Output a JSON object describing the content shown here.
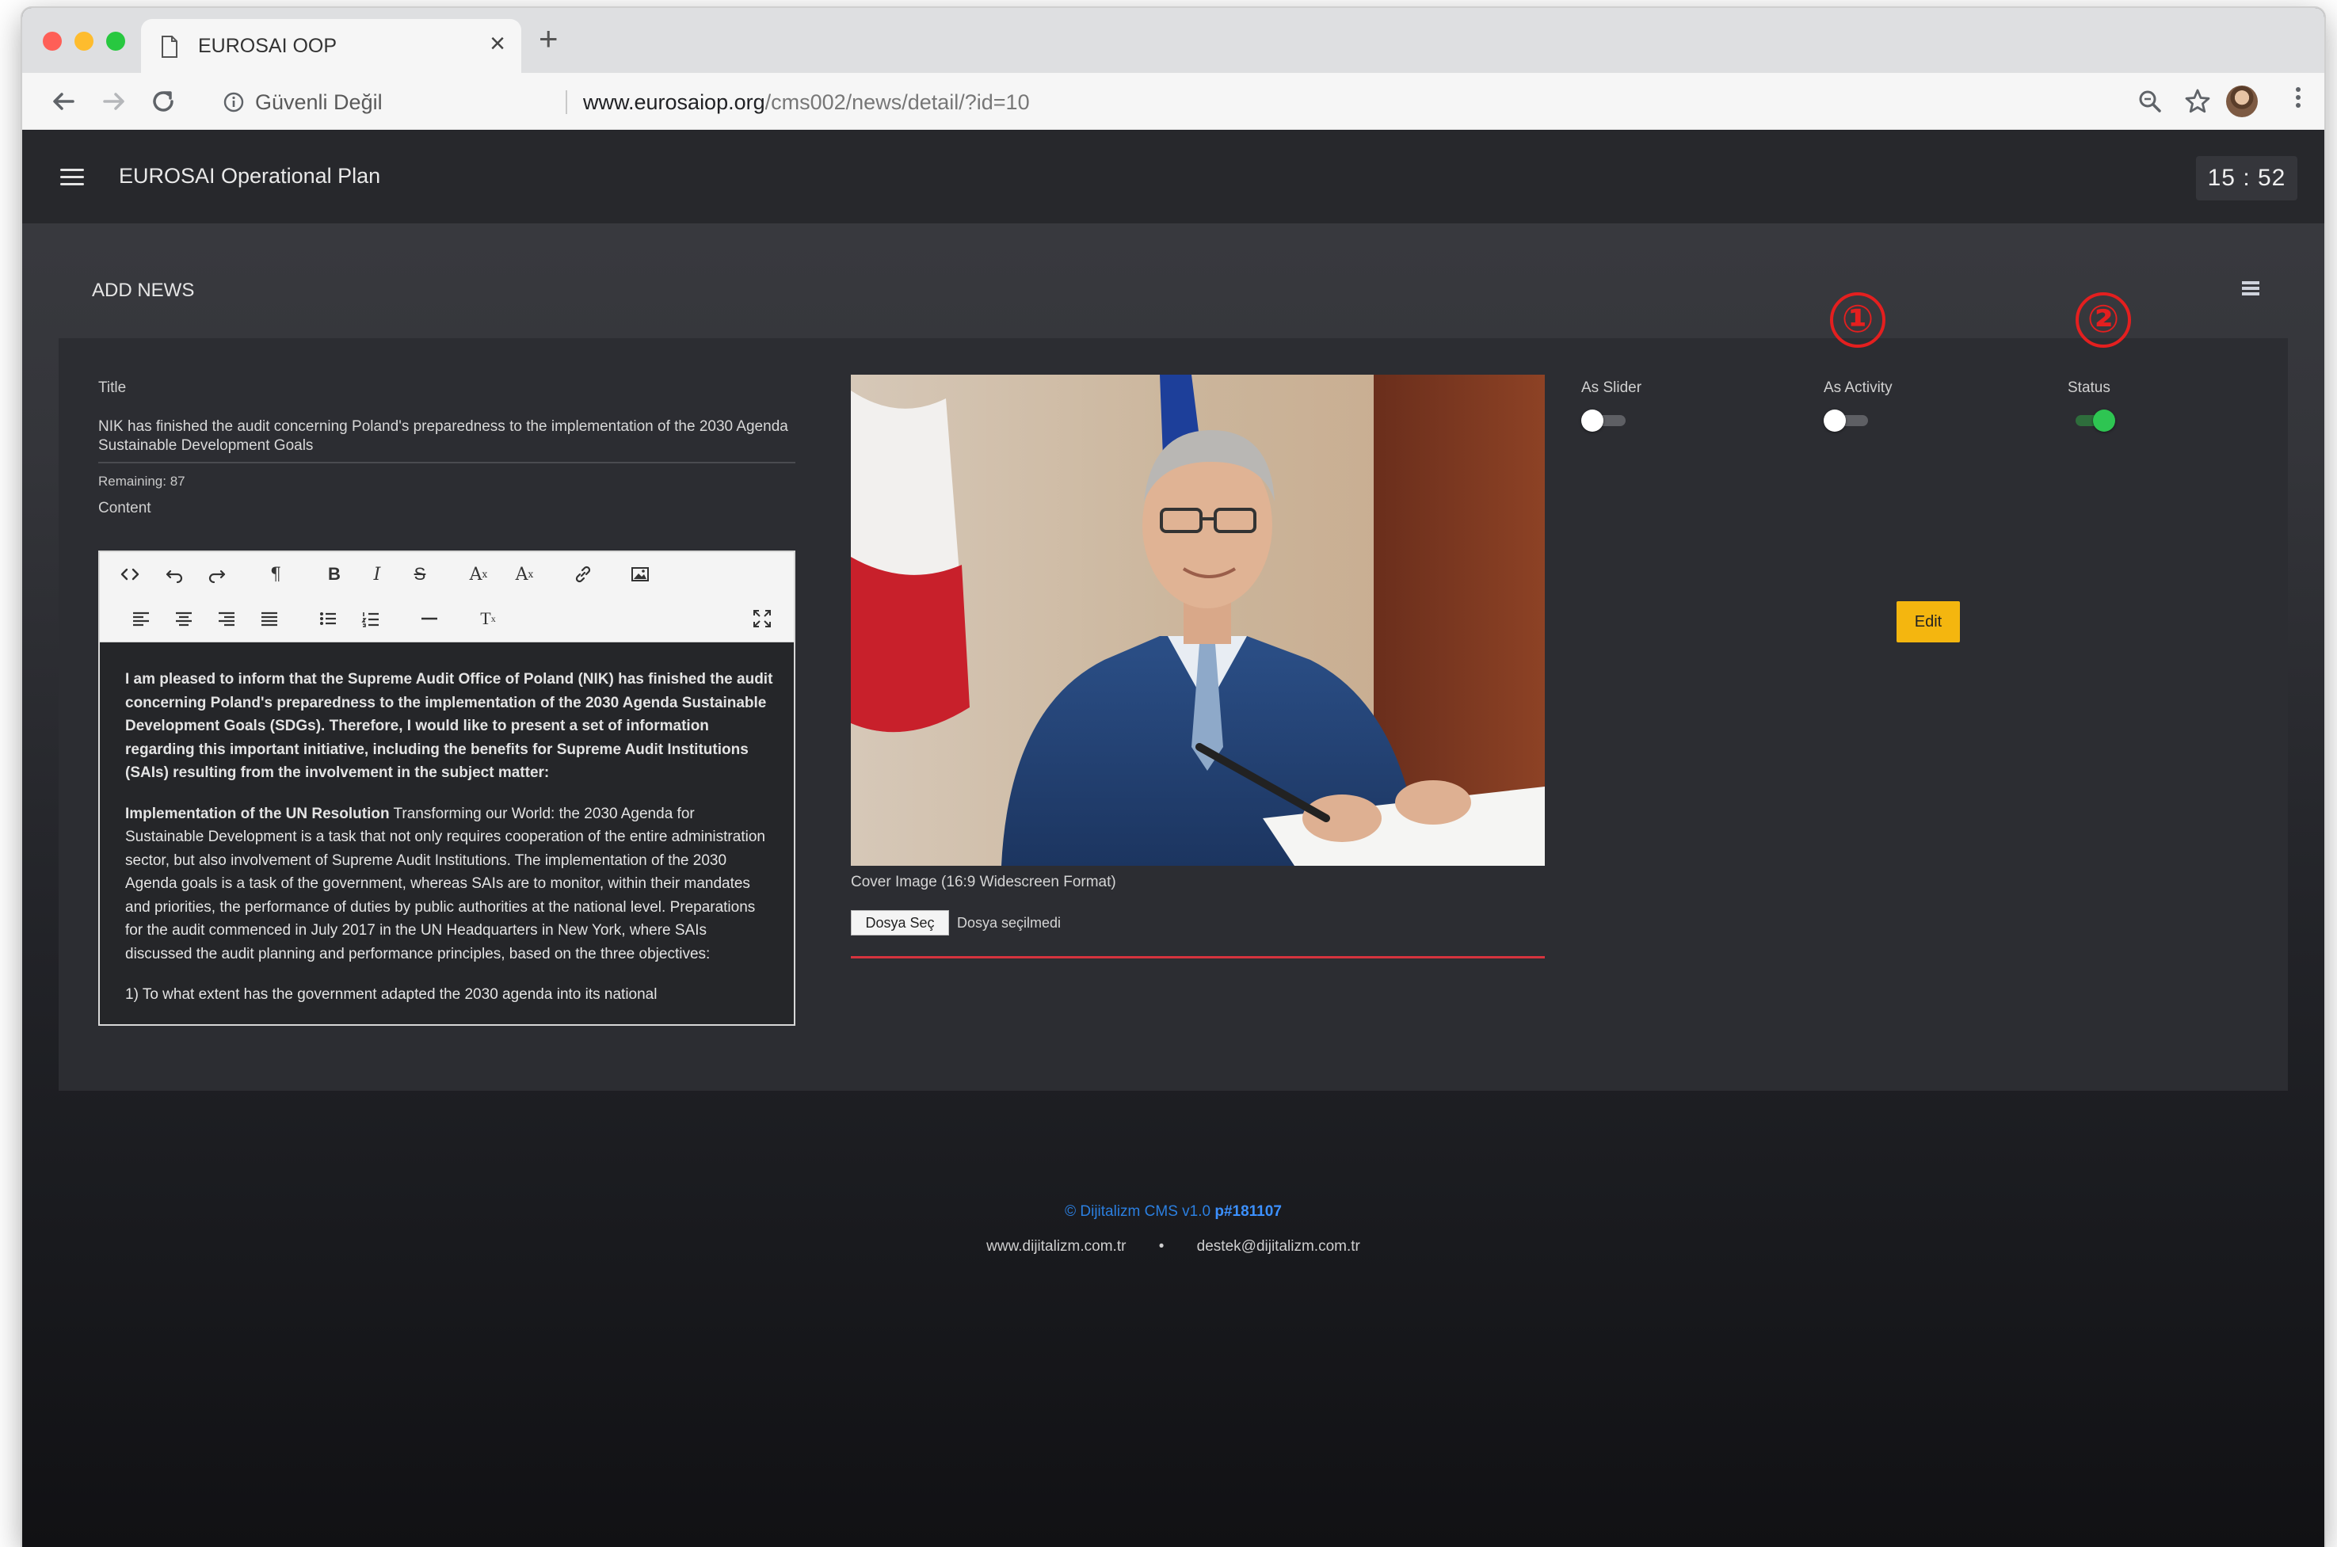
{
  "browser": {
    "tab_title": "EUROSAI OOP",
    "security_label": "Güvenli Değil",
    "url_host": "www.eurosaiop.org",
    "url_path": "/cms002/news/detail/?id=10"
  },
  "app": {
    "title": "EUROSAI Operational Plan",
    "clock": "15 : 52",
    "section_title": "ADD NEWS"
  },
  "form": {
    "title_label": "Title",
    "title_value": "NIK has finished the audit concerning Poland's preparedness to the implementation of the 2030 Agenda Sustainable Development Goals",
    "remaining": "Remaining: 87",
    "content_label": "Content",
    "content": {
      "paragraph1": "I am pleased to inform that the Supreme Audit Office of Poland (NIK) has finished the audit concerning Poland's preparedness to the implementation of the 2030 Agenda Sustainable Development Goals (SDGs). Therefore, I would like to present a set of information regarding this important initiative, including the benefits for Supreme Audit Institutions (SAIs) resulting from the involvement in the subject matter:",
      "paragraph2_bold": "Implementation of the UN Resolution",
      "paragraph2_rest": " Transforming our World: the 2030 Agenda for Sustainable Development is a task that not only requires cooperation of the entire administration sector, but also involvement of Supreme Audit Institutions. The implementation of the 2030 Agenda goals is a task of the government, whereas SAIs are to monitor, within their mandates and priorities, the performance of duties by public authorities at the national level. Preparations for the audit commenced in July 2017 in the UN Headquarters in New York, where SAIs discussed the audit planning and performance principles, based on the three objectives:",
      "paragraph3": "1) To what extent has the government adapted the 2030 agenda into its national"
    },
    "cover_caption": "Cover Image (16:9 Widescreen Format)",
    "file_button": "Dosya Seç",
    "file_status": "Dosya seçilmedi",
    "as_slider_label": "As Slider",
    "as_activity_label": "As Activity",
    "status_label": "Status",
    "edit_button": "Edit"
  },
  "toggles": {
    "as_slider": false,
    "as_activity": false,
    "status": true
  },
  "annotations": [
    "①",
    "②"
  ],
  "footer": {
    "brand": "© Dijitalizm CMS v1.0 ",
    "build": "p#181107",
    "website": "www.dijitalizm.com.tr",
    "separator": "•",
    "email": "destek@dijitalizm.com.tr"
  },
  "colors": {
    "accent_yellow": "#f4b60f",
    "status_green": "#2ec552",
    "annotation_red": "#e41f1f",
    "footer_blue": "#2b7fe0",
    "file_underline": "#d6343e"
  },
  "icons": [
    "file-icon",
    "close-icon",
    "plus-icon",
    "back-arrow-icon",
    "forward-arrow-icon",
    "reload-icon",
    "info-icon",
    "zoom-icon",
    "star-icon",
    "kebab-menu-icon",
    "hamburger-icon",
    "list-icon",
    "code-view-icon",
    "undo-icon",
    "redo-icon",
    "paragraph-icon",
    "bold-icon",
    "italic-icon",
    "strikethrough-icon",
    "superscript-icon",
    "subscript-icon",
    "link-icon",
    "image-icon",
    "align-left-icon",
    "align-center-icon",
    "align-right-icon",
    "justify-icon",
    "bulleted-list-icon",
    "numbered-list-icon",
    "horizontal-rule-icon",
    "clear-format-icon",
    "fullscreen-icon"
  ]
}
